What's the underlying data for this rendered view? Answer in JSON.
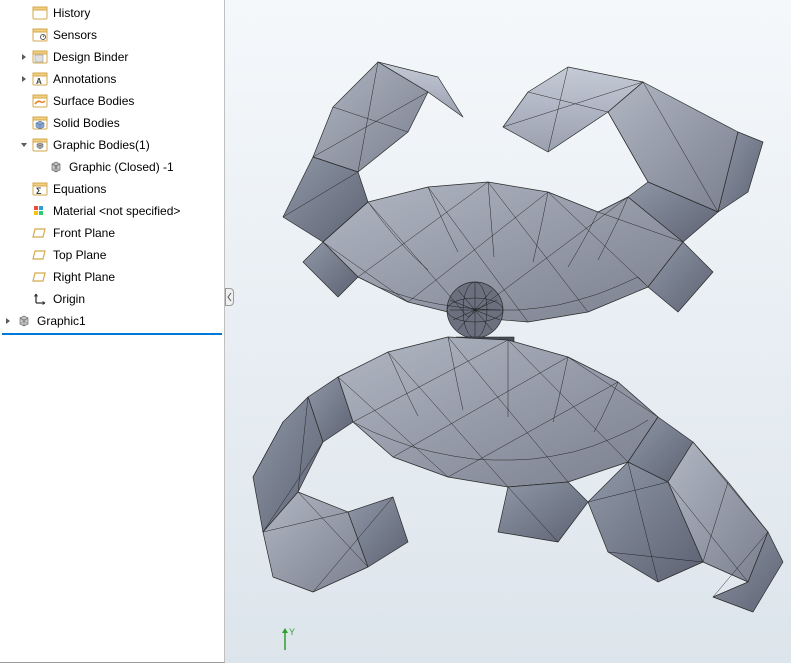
{
  "tree": {
    "history": "History",
    "sensors": "Sensors",
    "design_binder": "Design Binder",
    "annotations": "Annotations",
    "surface_bodies": "Surface Bodies",
    "solid_bodies": "Solid Bodies",
    "graphic_bodies": "Graphic Bodies(1)",
    "graphic_closed": "Graphic (Closed) -1",
    "equations": "Equations",
    "material": "Material <not specified>",
    "front_plane": "Front Plane",
    "top_plane": "Top Plane",
    "right_plane": "Right Plane",
    "origin": "Origin",
    "graphic1": "Graphic1"
  },
  "axis_label": "Y"
}
